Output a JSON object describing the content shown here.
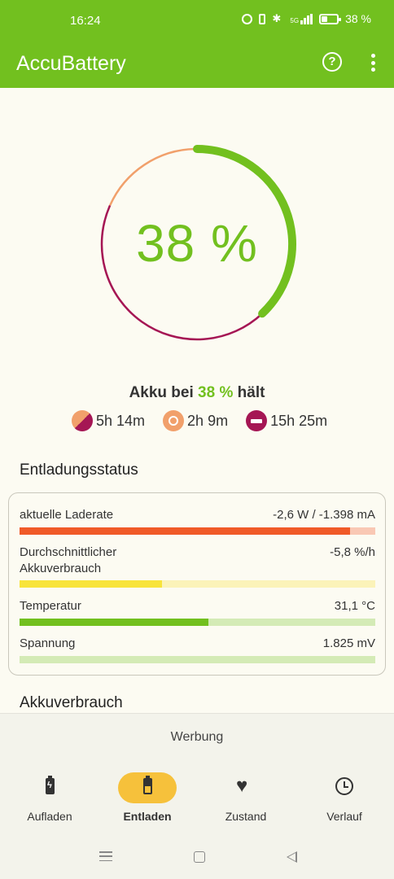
{
  "status_bar": {
    "time": "16:24",
    "network": "5G",
    "battery_text": "38 %",
    "battery_level": 0.38
  },
  "app_bar": {
    "title": "AccuBattery",
    "help_icon": "help-circle-icon",
    "menu_icon": "more-vertical-icon"
  },
  "gauge": {
    "percent_text": "38 %",
    "level": 0.38,
    "colors": {
      "charge": "#72c01f",
      "screen_on": "#f1a06b",
      "screen_off": "#a51654"
    }
  },
  "holds": {
    "prefix": "Akku bei",
    "percent": "38 %",
    "suffix": "hält"
  },
  "times": [
    {
      "icon": "mixed-usage-icon",
      "value": "5h 14m"
    },
    {
      "icon": "screen-on-icon",
      "value": "2h 9m"
    },
    {
      "icon": "sleep-icon",
      "value": "15h 25m"
    }
  ],
  "discharge": {
    "title": "Entladungsstatus",
    "rows": [
      {
        "label": "aktuelle Laderate",
        "value": "-2,6 W / -1.398 mA",
        "fill": 0.93,
        "color": "#f05a28",
        "track": "#f9c8b4"
      },
      {
        "label": "Durchschnittlicher Akkuverbrauch",
        "value": "-5,8 %/h",
        "fill": 0.4,
        "color": "#f8e43a",
        "track": "#fbf3b9"
      },
      {
        "label": "Temperatur",
        "value": "31,1 °C",
        "fill": 0.53,
        "color": "#72c01f",
        "track": "#d4ebb6"
      },
      {
        "label": "Spannung",
        "value": "1.825 mV",
        "fill": 0.0,
        "color": "#72c01f",
        "track": "#d4ebb6"
      }
    ]
  },
  "usage_title": "Akkuverbrauch",
  "ad_label": "Werbung",
  "bottom_nav": [
    {
      "label": "Aufladen",
      "icon": "battery-charging-icon",
      "active": false
    },
    {
      "label": "Entladen",
      "icon": "battery-discharging-icon",
      "active": true
    },
    {
      "label": "Zustand",
      "icon": "heart-icon",
      "active": false
    },
    {
      "label": "Verlauf",
      "icon": "history-icon",
      "active": false
    }
  ]
}
